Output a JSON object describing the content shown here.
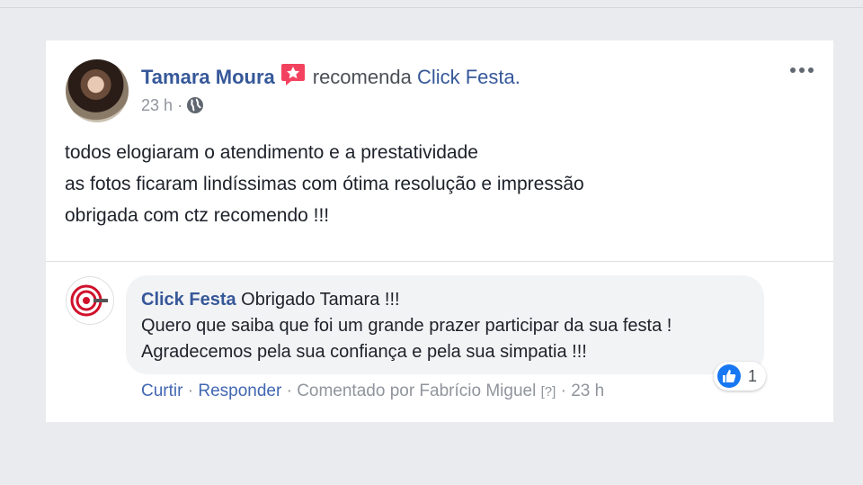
{
  "post": {
    "author": "Tamara Moura",
    "action_text": "recomenda",
    "page_name": "Click Festa.",
    "time": "23 h",
    "separator": "·",
    "lines": [
      "todos elogiaram o atendimento e a prestatividade",
      "as fotos ficaram lindíssimas com ótima resolução e impressão",
      "obrigada com ctz recomendo !!!"
    ],
    "icons": {
      "badge": "star-badge-icon",
      "privacy": "globe-icon",
      "more": "more-options-icon"
    },
    "colors": {
      "link": "#365899",
      "badge": "#f3425f"
    }
  },
  "comment": {
    "author": "Click Festa",
    "first_line": "Obrigado Tamara !!!",
    "line2": "Quero que saiba que foi um grande prazer participar da sua festa !",
    "line3": "Agradecemos pela sua confiança e pela sua simpatia !!!",
    "reaction_count": "1",
    "actions": {
      "like": "Curtir",
      "reply": "Responder",
      "commented_by": "Comentado por Fabrício Miguel",
      "help": "[?]",
      "time": "23 h",
      "sep": "·"
    },
    "colors": {
      "bubble": "#f2f3f5",
      "like": "#1877f2",
      "logo": "#d0112b"
    }
  }
}
